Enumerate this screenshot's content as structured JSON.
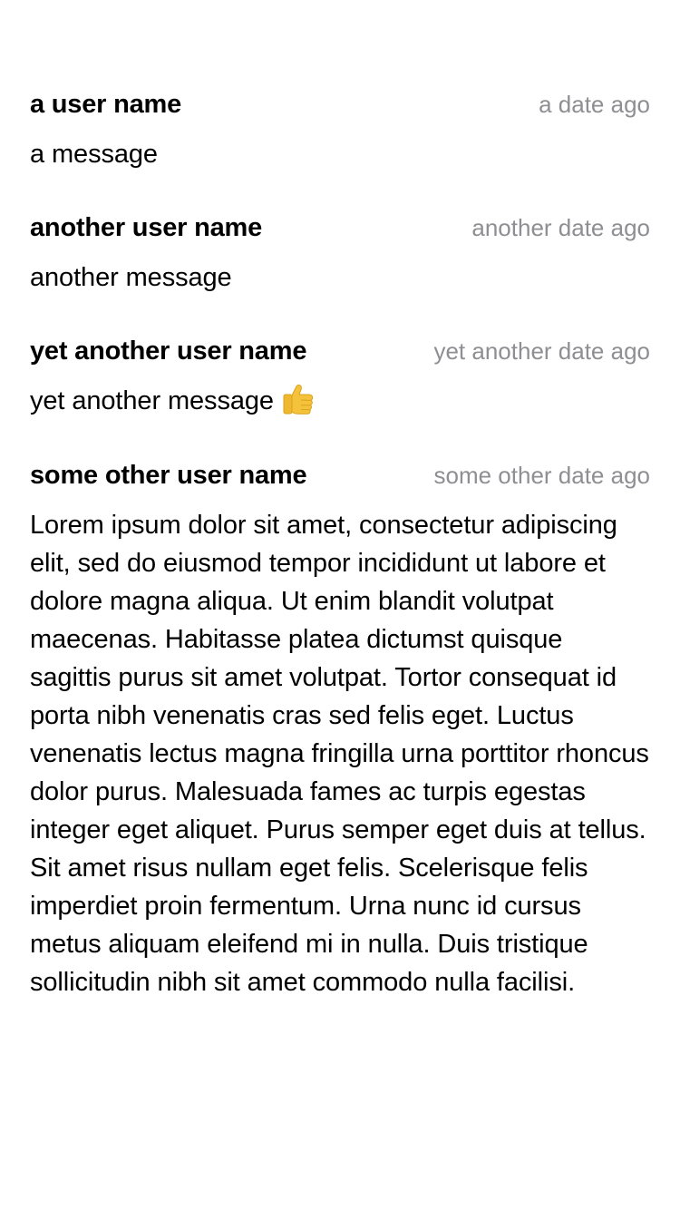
{
  "comments": [
    {
      "username": "a user name",
      "timestamp": "a date ago",
      "message": "a message"
    },
    {
      "username": "another user name",
      "timestamp": "another date ago",
      "message": "another message"
    },
    {
      "username": "yet another user name",
      "timestamp": "yet another date ago",
      "message": "yet another message",
      "emoji": "thumbs-up-icon"
    },
    {
      "username": "some other user name",
      "timestamp": "some other date ago",
      "message": "Lorem ipsum dolor sit amet, consectetur adipiscing elit, sed do eiusmod tempor incididunt ut labore et dolore magna aliqua. Ut enim blandit volutpat maecenas. Habitasse platea dictumst quisque sagittis purus sit amet volutpat. Tortor consequat id porta nibh venenatis cras sed felis eget. Luctus venenatis lectus magna fringilla urna porttitor rhoncus dolor purus. Malesuada fames ac turpis egestas integer eget aliquet. Purus semper eget duis at tellus. Sit amet risus nullam eget felis. Scelerisque felis imperdiet proin fermentum. Urna nunc id cursus metus aliquam eleifend mi in nulla. Duis tristique sollicitudin nibh sit amet commodo nulla facilisi."
    }
  ],
  "colors": {
    "text": "#000000",
    "timestamp": "#8e8e93",
    "background": "#ffffff"
  }
}
